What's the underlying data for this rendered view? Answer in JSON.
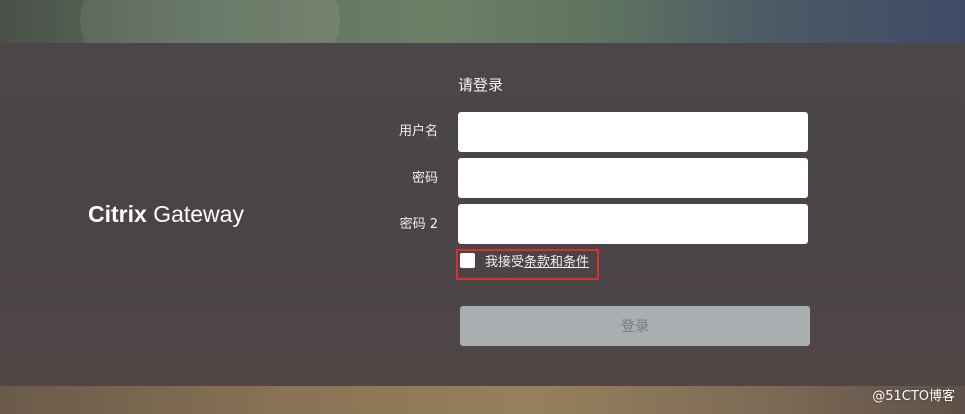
{
  "brand": {
    "name_bold": "Citrix",
    "name_regular": "Gateway"
  },
  "form": {
    "title": "请登录",
    "username": {
      "label": "用户名",
      "value": "",
      "placeholder": ""
    },
    "password": {
      "label": "密码",
      "value": "",
      "placeholder": ""
    },
    "password2": {
      "label": "密码 2",
      "value": "",
      "placeholder": ""
    },
    "terms": {
      "checked": false,
      "prefix": "我接受",
      "link": "条款和条件"
    },
    "login_label": "登录"
  },
  "watermark": "@51CTO博客",
  "colors": {
    "panel": "#4a4447",
    "input_bg": "#ffffff",
    "button_bg": "#abaeb1",
    "button_text": "#7a7d80",
    "highlight_border": "#d8302f"
  }
}
